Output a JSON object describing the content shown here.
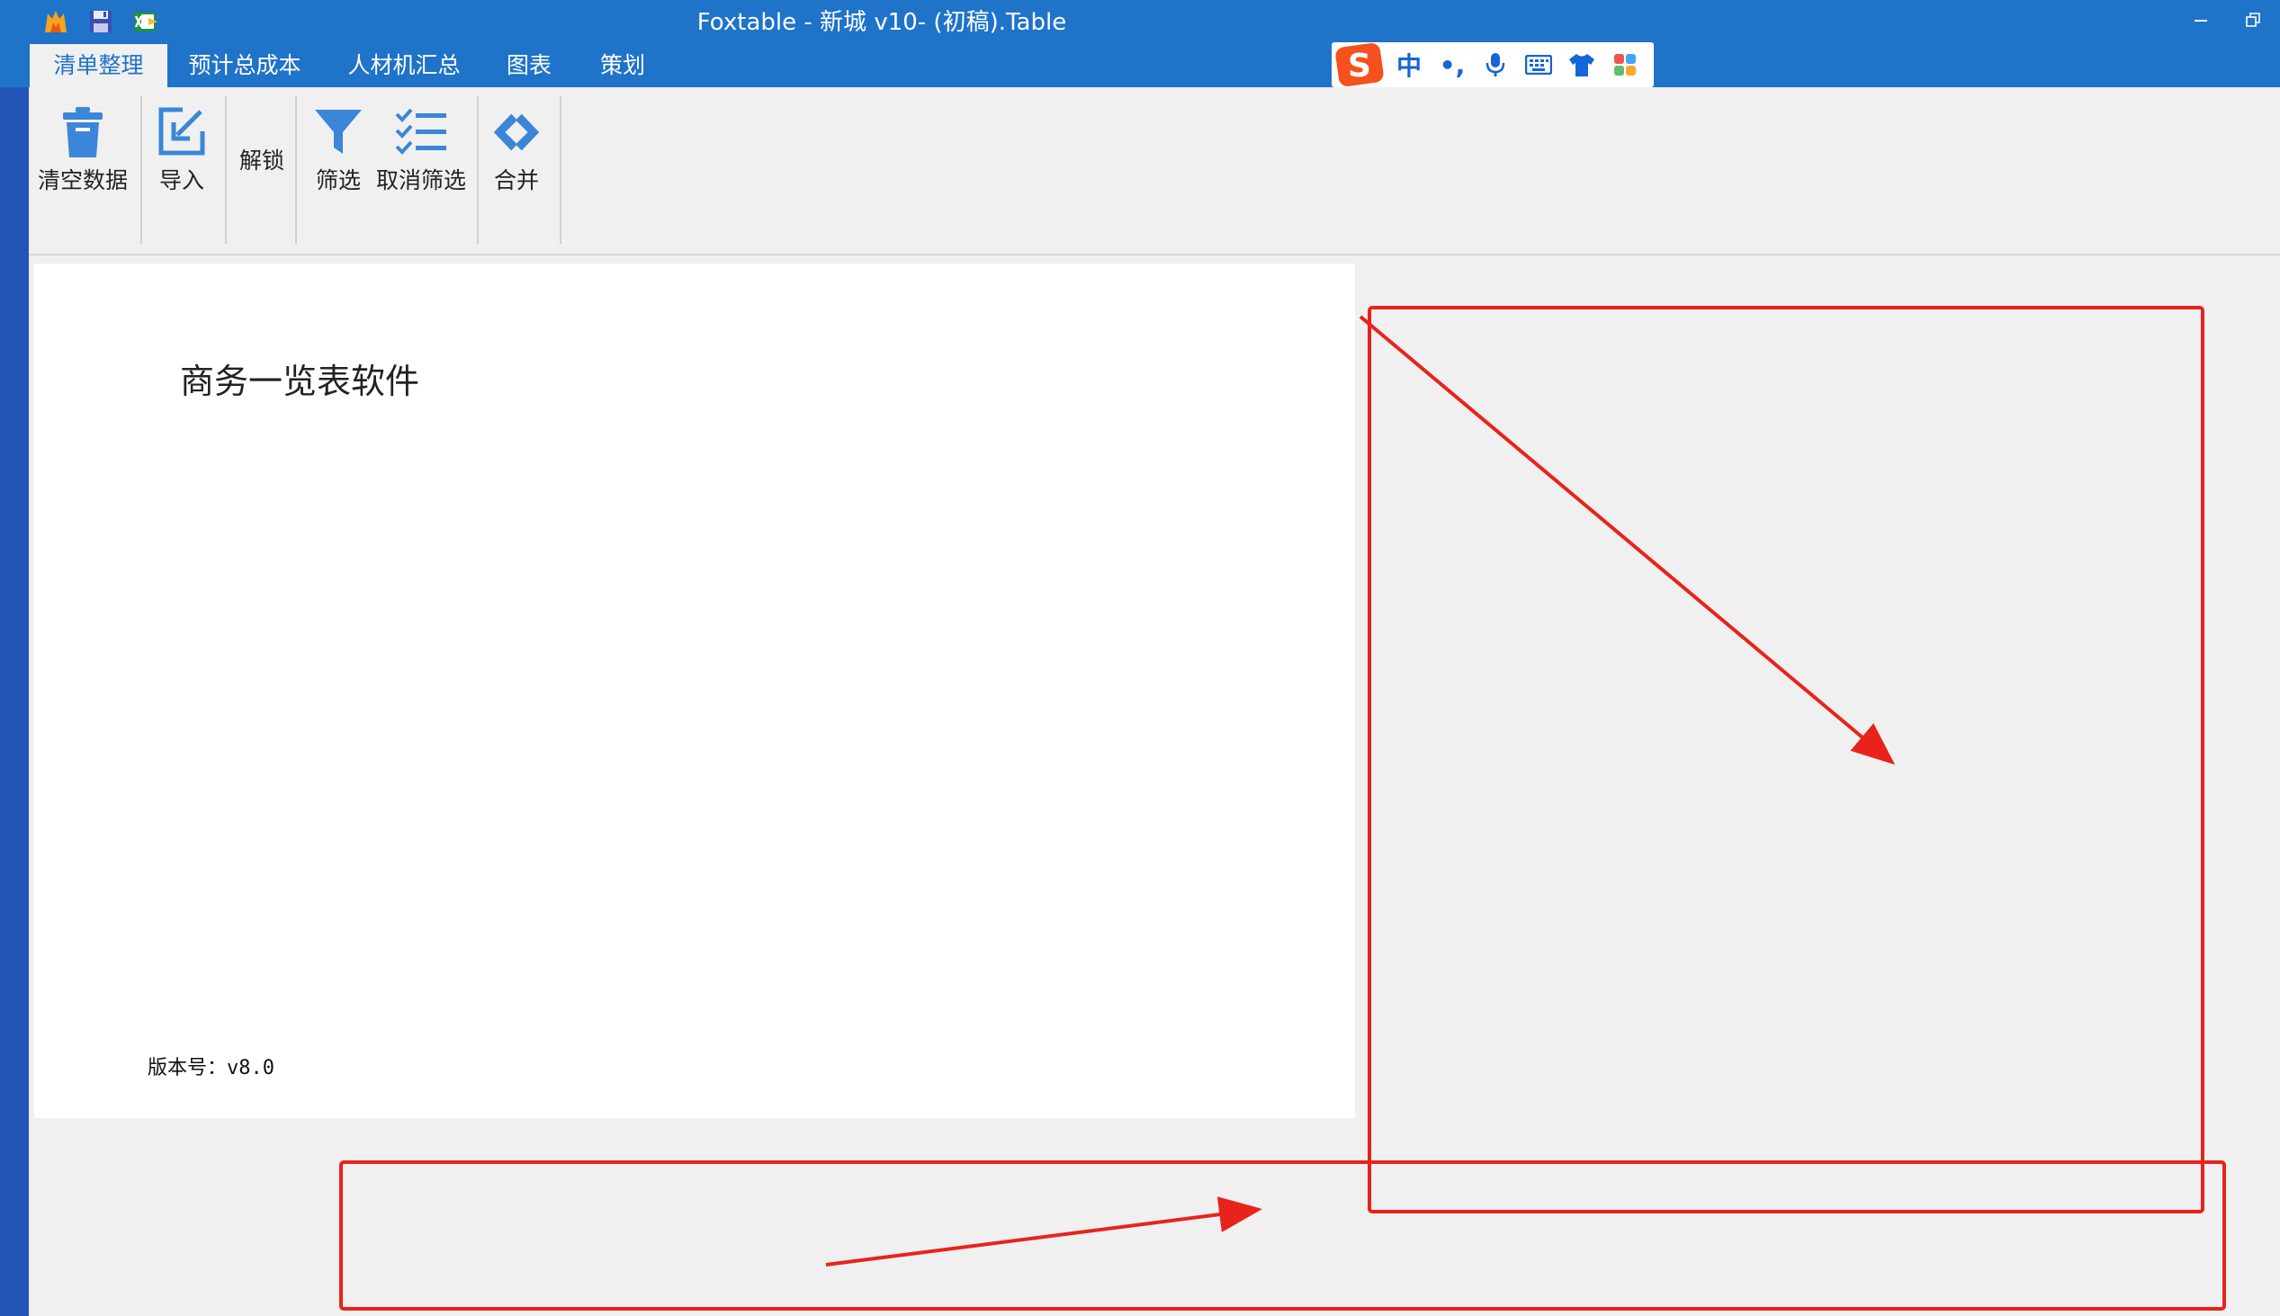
{
  "window": {
    "title": "Foxtable - 新城 v10- (初稿).Table"
  },
  "quick_access": [
    {
      "icon": "app-logo-icon"
    },
    {
      "icon": "save-icon"
    },
    {
      "icon": "excel-export-icon"
    }
  ],
  "tabs": [
    {
      "label": "清单整理",
      "active": true
    },
    {
      "label": "预计总成本",
      "active": false
    },
    {
      "label": "人材机汇总",
      "active": false
    },
    {
      "label": "图表",
      "active": false
    },
    {
      "label": "策划",
      "active": false
    }
  ],
  "ime_toolbar": {
    "logo": "S",
    "lang": "中",
    "punct": "•,",
    "icons": [
      "microphone-icon",
      "keyboard-icon",
      "skin-shirt-icon",
      "toolbox-icon"
    ]
  },
  "ribbon": {
    "clear_data": "清空数据",
    "import": "导入",
    "unlock": "解锁",
    "filter": "筛选",
    "cancel_filter": "取消筛选",
    "merge": "合并"
  },
  "document": {
    "title": "商务一览表软件",
    "version_label": "版本号：",
    "version_value": "v8.0"
  },
  "colors": {
    "titlebar": "#1f73c9",
    "accent_icon": "#3b86d8",
    "annotation": "#e8231c",
    "window_bg": "#f0f0f0"
  }
}
